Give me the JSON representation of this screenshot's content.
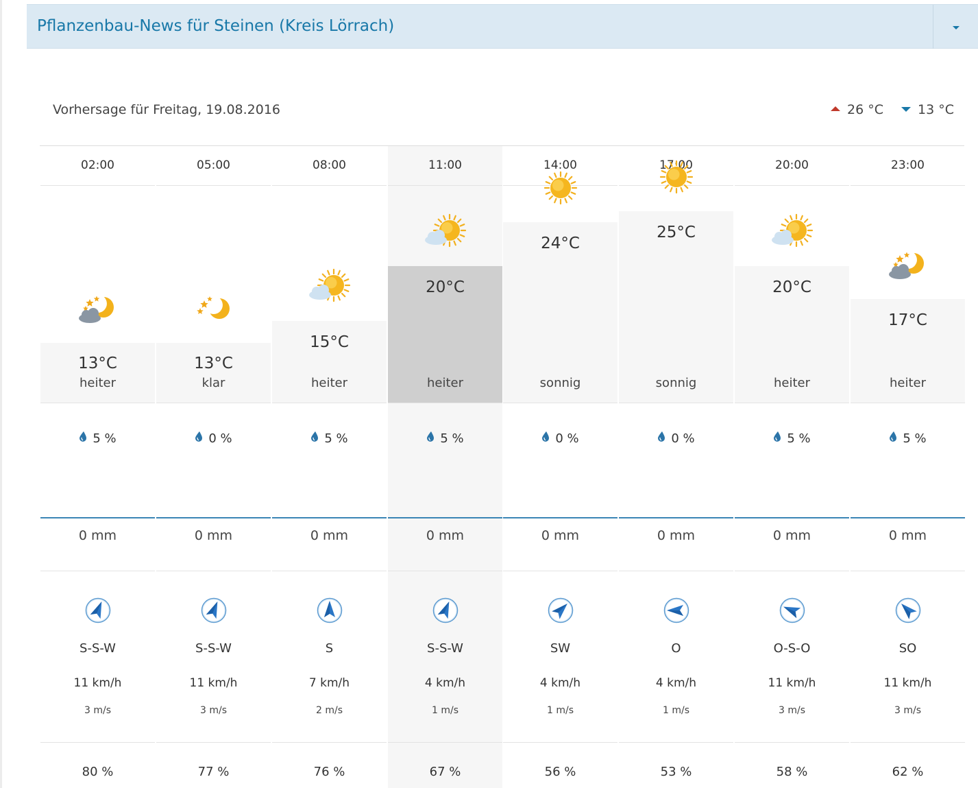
{
  "panel": {
    "title": "Pflanzenbau-News für Steinen (Kreis Lörrach)"
  },
  "forecast": {
    "label": "Vorhersage für Freitag, 19.08.2016",
    "max_temp": "26 °C",
    "min_temp": "13 °C"
  },
  "colors": {
    "accent": "#1878a8",
    "header_bg": "#dbe9f3",
    "max_arrow": "#c0392b",
    "min_arrow": "#1878a8",
    "highlight_bar": "#cfcfcf"
  },
  "columns": [
    {
      "time": "02:00",
      "icon": "moon-stars-cloud-icon",
      "temp": "13°C",
      "temp_value": 13,
      "desc": "heiter",
      "rain_prob": "5 %",
      "precip": "0 mm",
      "wind_dir": "S-S-W",
      "wind_kmh": "11 km/h",
      "wind_ms": "3 m/s",
      "humidity": "80 %"
    },
    {
      "time": "05:00",
      "icon": "moon-stars-icon",
      "temp": "13°C",
      "temp_value": 13,
      "desc": "klar",
      "rain_prob": "0 %",
      "precip": "0 mm",
      "wind_dir": "S-S-W",
      "wind_kmh": "11 km/h",
      "wind_ms": "3 m/s",
      "humidity": "77 %"
    },
    {
      "time": "08:00",
      "icon": "sun-cloud-icon",
      "temp": "15°C",
      "temp_value": 15,
      "desc": "heiter",
      "rain_prob": "5 %",
      "precip": "0 mm",
      "wind_dir": "S",
      "wind_kmh": "7 km/h",
      "wind_ms": "2 m/s",
      "humidity": "76 %"
    },
    {
      "time": "11:00",
      "icon": "sun-cloud-icon",
      "temp": "20°C",
      "temp_value": 20,
      "desc": "heiter",
      "rain_prob": "5 %",
      "precip": "0 mm",
      "wind_dir": "S-S-W",
      "wind_kmh": "4 km/h",
      "wind_ms": "1 m/s",
      "humidity": "67 %",
      "highlight": true
    },
    {
      "time": "14:00",
      "icon": "sun-icon",
      "temp": "24°C",
      "temp_value": 24,
      "desc": "sonnig",
      "rain_prob": "0 %",
      "precip": "0 mm",
      "wind_dir": "SW",
      "wind_kmh": "4 km/h",
      "wind_ms": "1 m/s",
      "humidity": "56 %"
    },
    {
      "time": "17:00",
      "icon": "sun-icon",
      "temp": "25°C",
      "temp_value": 25,
      "desc": "sonnig",
      "rain_prob": "0 %",
      "precip": "0 mm",
      "wind_dir": "O",
      "wind_kmh": "4 km/h",
      "wind_ms": "1 m/s",
      "humidity": "53 %"
    },
    {
      "time": "20:00",
      "icon": "sun-cloud-icon",
      "temp": "20°C",
      "temp_value": 20,
      "desc": "heiter",
      "rain_prob": "5 %",
      "precip": "0 mm",
      "wind_dir": "O-S-O",
      "wind_kmh": "11 km/h",
      "wind_ms": "3 m/s",
      "humidity": "58 %"
    },
    {
      "time": "23:00",
      "icon": "moon-stars-cloud-icon",
      "temp": "17°C",
      "temp_value": 17,
      "desc": "heiter",
      "rain_prob": "5 %",
      "precip": "0 mm",
      "wind_dir": "SO",
      "wind_kmh": "11 km/h",
      "wind_ms": "3 m/s",
      "humidity": "62 %"
    }
  ]
}
